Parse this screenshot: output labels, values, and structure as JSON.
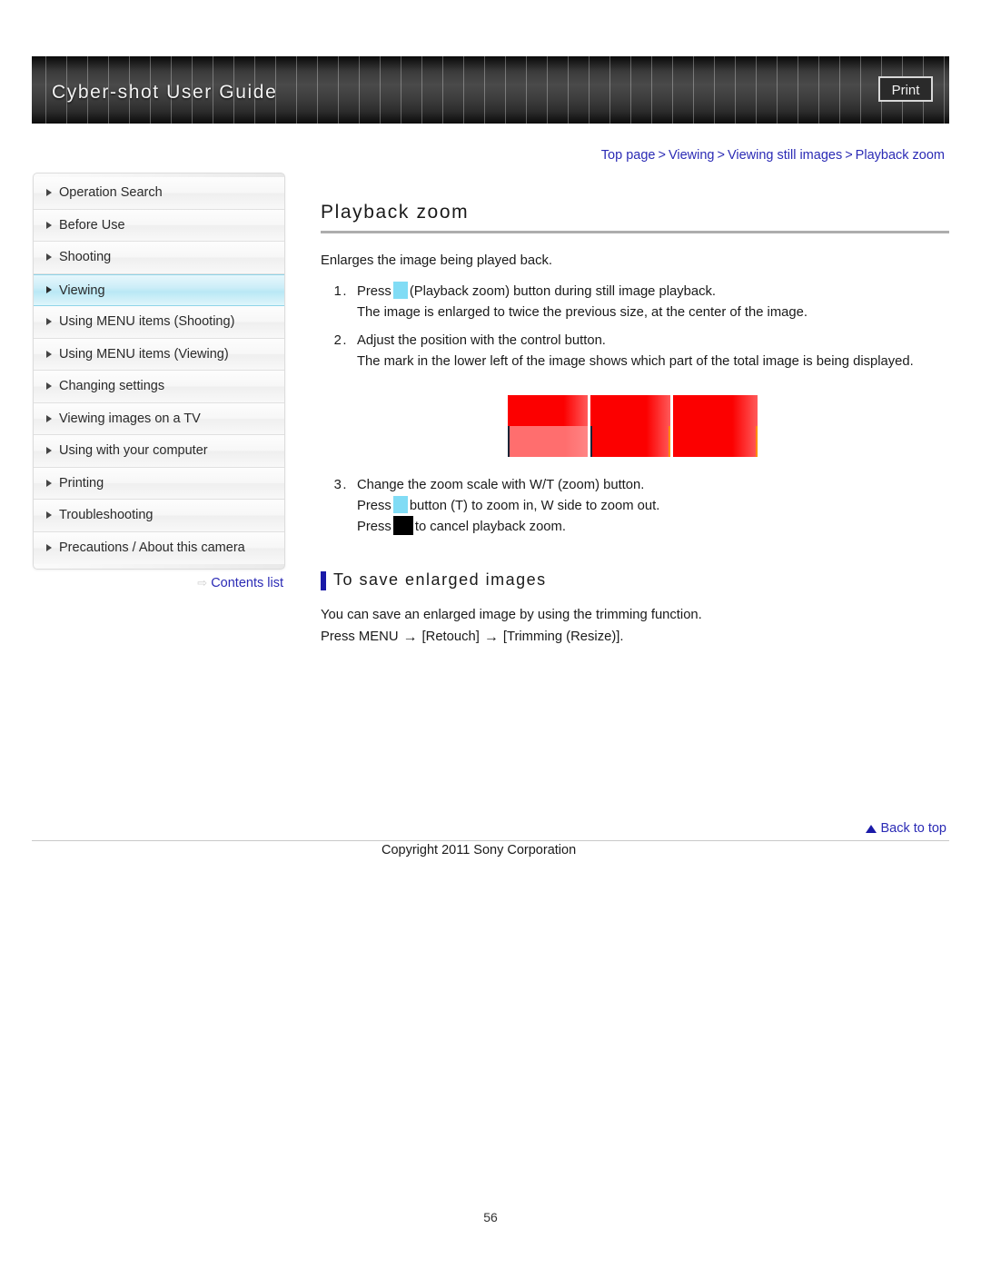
{
  "header": {
    "title": "Cyber-shot User Guide",
    "print_label": "Print"
  },
  "breadcrumb": {
    "items": [
      "Top page",
      "Viewing",
      "Viewing still images",
      "Playback zoom"
    ],
    "separator": ">"
  },
  "sidebar": {
    "items": [
      {
        "label": "Operation Search",
        "active": false
      },
      {
        "label": "Before Use",
        "active": false
      },
      {
        "label": "Shooting",
        "active": false
      },
      {
        "label": "Viewing",
        "active": true
      },
      {
        "label": "Using MENU items (Shooting)",
        "active": false
      },
      {
        "label": "Using MENU items (Viewing)",
        "active": false
      },
      {
        "label": "Changing settings",
        "active": false
      },
      {
        "label": "Viewing images on a TV",
        "active": false
      },
      {
        "label": "Using with your computer",
        "active": false
      },
      {
        "label": "Printing",
        "active": false
      },
      {
        "label": "Troubleshooting",
        "active": false
      },
      {
        "label": "Precautions / About this camera",
        "active": false
      }
    ],
    "contents_list_label": "Contents list",
    "contents_list_arrow": "⇨"
  },
  "main": {
    "title": "Playback zoom",
    "lead": "Enlarges the image being played back.",
    "steps": [
      {
        "num": "1.",
        "pre": "Press",
        "glyph": "cyan",
        "post": "(Playback zoom) button during still image playback.",
        "detail": "The image is enlarged to twice the previous size, at the center of the image."
      },
      {
        "num": "2.",
        "pre": "Adjust the position with the control button.",
        "glyph": "none",
        "post": "",
        "detail": "The mark in the lower left of the image shows which part of the total image is being displayed."
      }
    ],
    "step3": {
      "num": "3.",
      "headline": "Change the zoom scale with W/T (zoom) button.",
      "line2_pre": "Press",
      "line2_post": "button (T) to zoom in, W side to zoom out.",
      "line3_pre": "Press",
      "line3_post": "to cancel playback zoom."
    },
    "figure": {
      "alt": "playback zoom example image",
      "panel_colors": [
        "#fc0000",
        "#ff6e6e",
        "#ff5a5a",
        "#1b2436",
        "#ff8a00"
      ]
    },
    "subsection": {
      "title": "To save enlarged images",
      "line1": "You can save an enlarged image by using the trimming function.",
      "line2_pre": "Press MENU",
      "arrow": "→",
      "line2_mid": "[Retouch]",
      "line2_post": "[Trimming (Resize)]."
    }
  },
  "footer": {
    "back_to_top": "Back to top",
    "copyright": "Copyright 2011 Sony Corporation",
    "page_number": "56"
  },
  "colors": {
    "link": "#2b2bb5",
    "accent_bar": "#1a1aa8",
    "active_nav": "#b9e8f5",
    "glyph_cyan": "#81dcf5",
    "glyph_black": "#000000"
  }
}
